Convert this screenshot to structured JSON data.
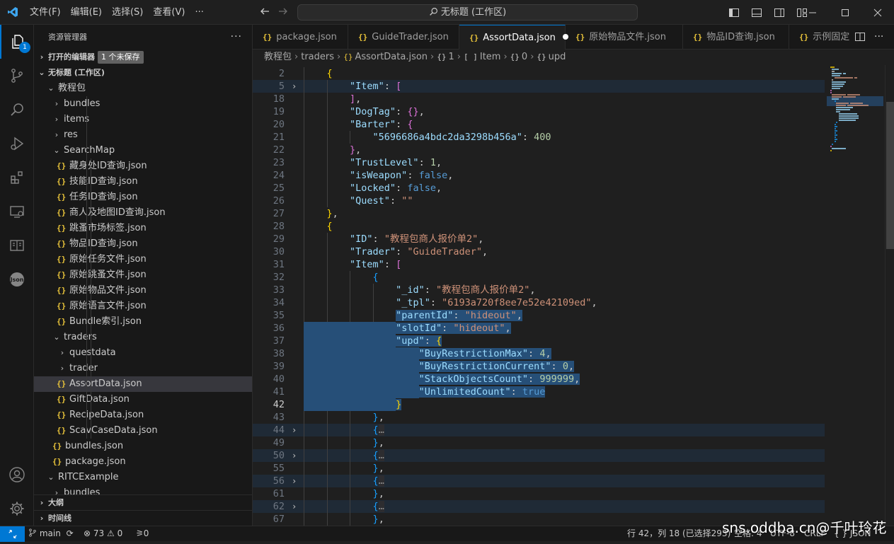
{
  "menu": [
    "文件(F)",
    "编辑(E)",
    "选择(S)",
    "查看(V)",
    "···"
  ],
  "command_center": "无标题 (工作区)",
  "activity": {
    "explorer_badge": "1"
  },
  "sidebar": {
    "title": "资源管理器",
    "more": "···",
    "open_editors": "打开的编辑器",
    "unsaved": "1 个未保存",
    "workspace": "无标题 (工作区)",
    "outline": "大纲",
    "timeline": "时间线",
    "tree": [
      {
        "label": "教程包",
        "type": "folder",
        "open": true,
        "depth": 1
      },
      {
        "label": "bundles",
        "type": "folder",
        "open": false,
        "depth": 2
      },
      {
        "label": "items",
        "type": "folder",
        "open": false,
        "depth": 2
      },
      {
        "label": "res",
        "type": "folder",
        "open": false,
        "depth": 2
      },
      {
        "label": "SearchMap",
        "type": "folder",
        "open": true,
        "depth": 2
      },
      {
        "label": "藏身处ID查询.json",
        "type": "json",
        "depth": 3
      },
      {
        "label": "技能ID查询.json",
        "type": "json",
        "depth": 3
      },
      {
        "label": "任务ID查询.json",
        "type": "json",
        "depth": 3
      },
      {
        "label": "商人及地图ID查询.json",
        "type": "json",
        "depth": 3
      },
      {
        "label": "跳蚤市场标签.json",
        "type": "json",
        "depth": 3
      },
      {
        "label": "物品ID查询.json",
        "type": "json",
        "depth": 3
      },
      {
        "label": "原始任务文件.json",
        "type": "json",
        "depth": 3
      },
      {
        "label": "原始跳蚤文件.json",
        "type": "json",
        "depth": 3
      },
      {
        "label": "原始物品文件.json",
        "type": "json",
        "depth": 3
      },
      {
        "label": "原始语言文件.json",
        "type": "json",
        "depth": 3
      },
      {
        "label": "Bundle索引.json",
        "type": "json",
        "depth": 3
      },
      {
        "label": "traders",
        "type": "folder",
        "open": true,
        "depth": 2
      },
      {
        "label": "questdata",
        "type": "folder",
        "open": false,
        "depth": 3
      },
      {
        "label": "trader",
        "type": "folder",
        "open": false,
        "depth": 3
      },
      {
        "label": "AssortData.json",
        "type": "json",
        "depth": 3,
        "selected": true
      },
      {
        "label": "GiftData.json",
        "type": "json",
        "depth": 3
      },
      {
        "label": "RecipeData.json",
        "type": "json",
        "depth": 3
      },
      {
        "label": "ScavCaseData.json",
        "type": "json",
        "depth": 3
      },
      {
        "label": "bundles.json",
        "type": "json",
        "depth": 2
      },
      {
        "label": "package.json",
        "type": "json",
        "depth": 2
      },
      {
        "label": "RITCExample",
        "type": "folder",
        "open": true,
        "depth": 1
      },
      {
        "label": "bundles",
        "type": "folder",
        "open": false,
        "depth": 2
      }
    ]
  },
  "tabs": [
    {
      "label": "package.json",
      "active": false
    },
    {
      "label": "GuideTrader.json",
      "active": false
    },
    {
      "label": "AssortData.json",
      "active": true,
      "dirty": true
    },
    {
      "label": "原始物品文件.json",
      "active": false
    },
    {
      "label": "物品ID查询.json",
      "active": false
    },
    {
      "label": "示例固定",
      "active": false
    }
  ],
  "breadcrumb": [
    "教程包",
    "traders",
    "AssortData.json",
    "1",
    "Item",
    "0",
    "upd"
  ],
  "code": {
    "line_numbers": [
      "2",
      "5",
      "18",
      "19",
      "20",
      "21",
      "22",
      "23",
      "24",
      "25",
      "26",
      "27",
      "28",
      "29",
      "30",
      "31",
      "32",
      "33",
      "34",
      "35",
      "36",
      "37",
      "38",
      "39",
      "40",
      "41",
      "42",
      "43",
      "44",
      "49",
      "50",
      "55",
      "56",
      "61",
      "62",
      "67"
    ],
    "current_line": "42",
    "lines": [
      "{",
      "\"Item\": [",
      "],",
      "\"DogTag\": {},",
      "\"Barter\": {",
      "\"5696686a4bdc2da3298b456a\": 400",
      "},",
      "\"TrustLevel\": 1,",
      "\"isWeapon\": false,",
      "\"Locked\": false,",
      "\"Quest\": \"\"",
      "},",
      "{",
      "\"ID\": \"教程包商人报价单2\",",
      "\"Trader\": \"GuideTrader\",",
      "\"Item\": [",
      "{",
      "\"_id\": \"教程包商人报价单2\",",
      "\"_tpl\": \"6193a720f8ee7e52e42109ed\",",
      "\"parentId\": \"hideout\",",
      "\"slotId\": \"hideout\",",
      "\"upd\": {",
      "\"BuyRestrictionMax\": 4,",
      "\"BuyRestrictionCurrent\": 0,",
      "\"StackObjectsCount\": 999999,",
      "\"UnlimitedCount\": true",
      "}",
      "},",
      "{…",
      "},",
      "{…",
      "},",
      "{…",
      "},",
      "{…",
      "},"
    ]
  },
  "status": {
    "branch": "main",
    "errors": "73",
    "warnings": "0",
    "ports": "0",
    "position": "行 42，列 18 (已选择293)",
    "spaces": "空格: 4",
    "encoding": "UTF-8",
    "eol": "CRLF",
    "language": "JSON"
  },
  "watermark": "sns.oddba.cn@千叶玲花",
  "colors": {
    "accent": "#0078d4",
    "selection": "#264f78",
    "json_icon": "#e8c33a"
  }
}
